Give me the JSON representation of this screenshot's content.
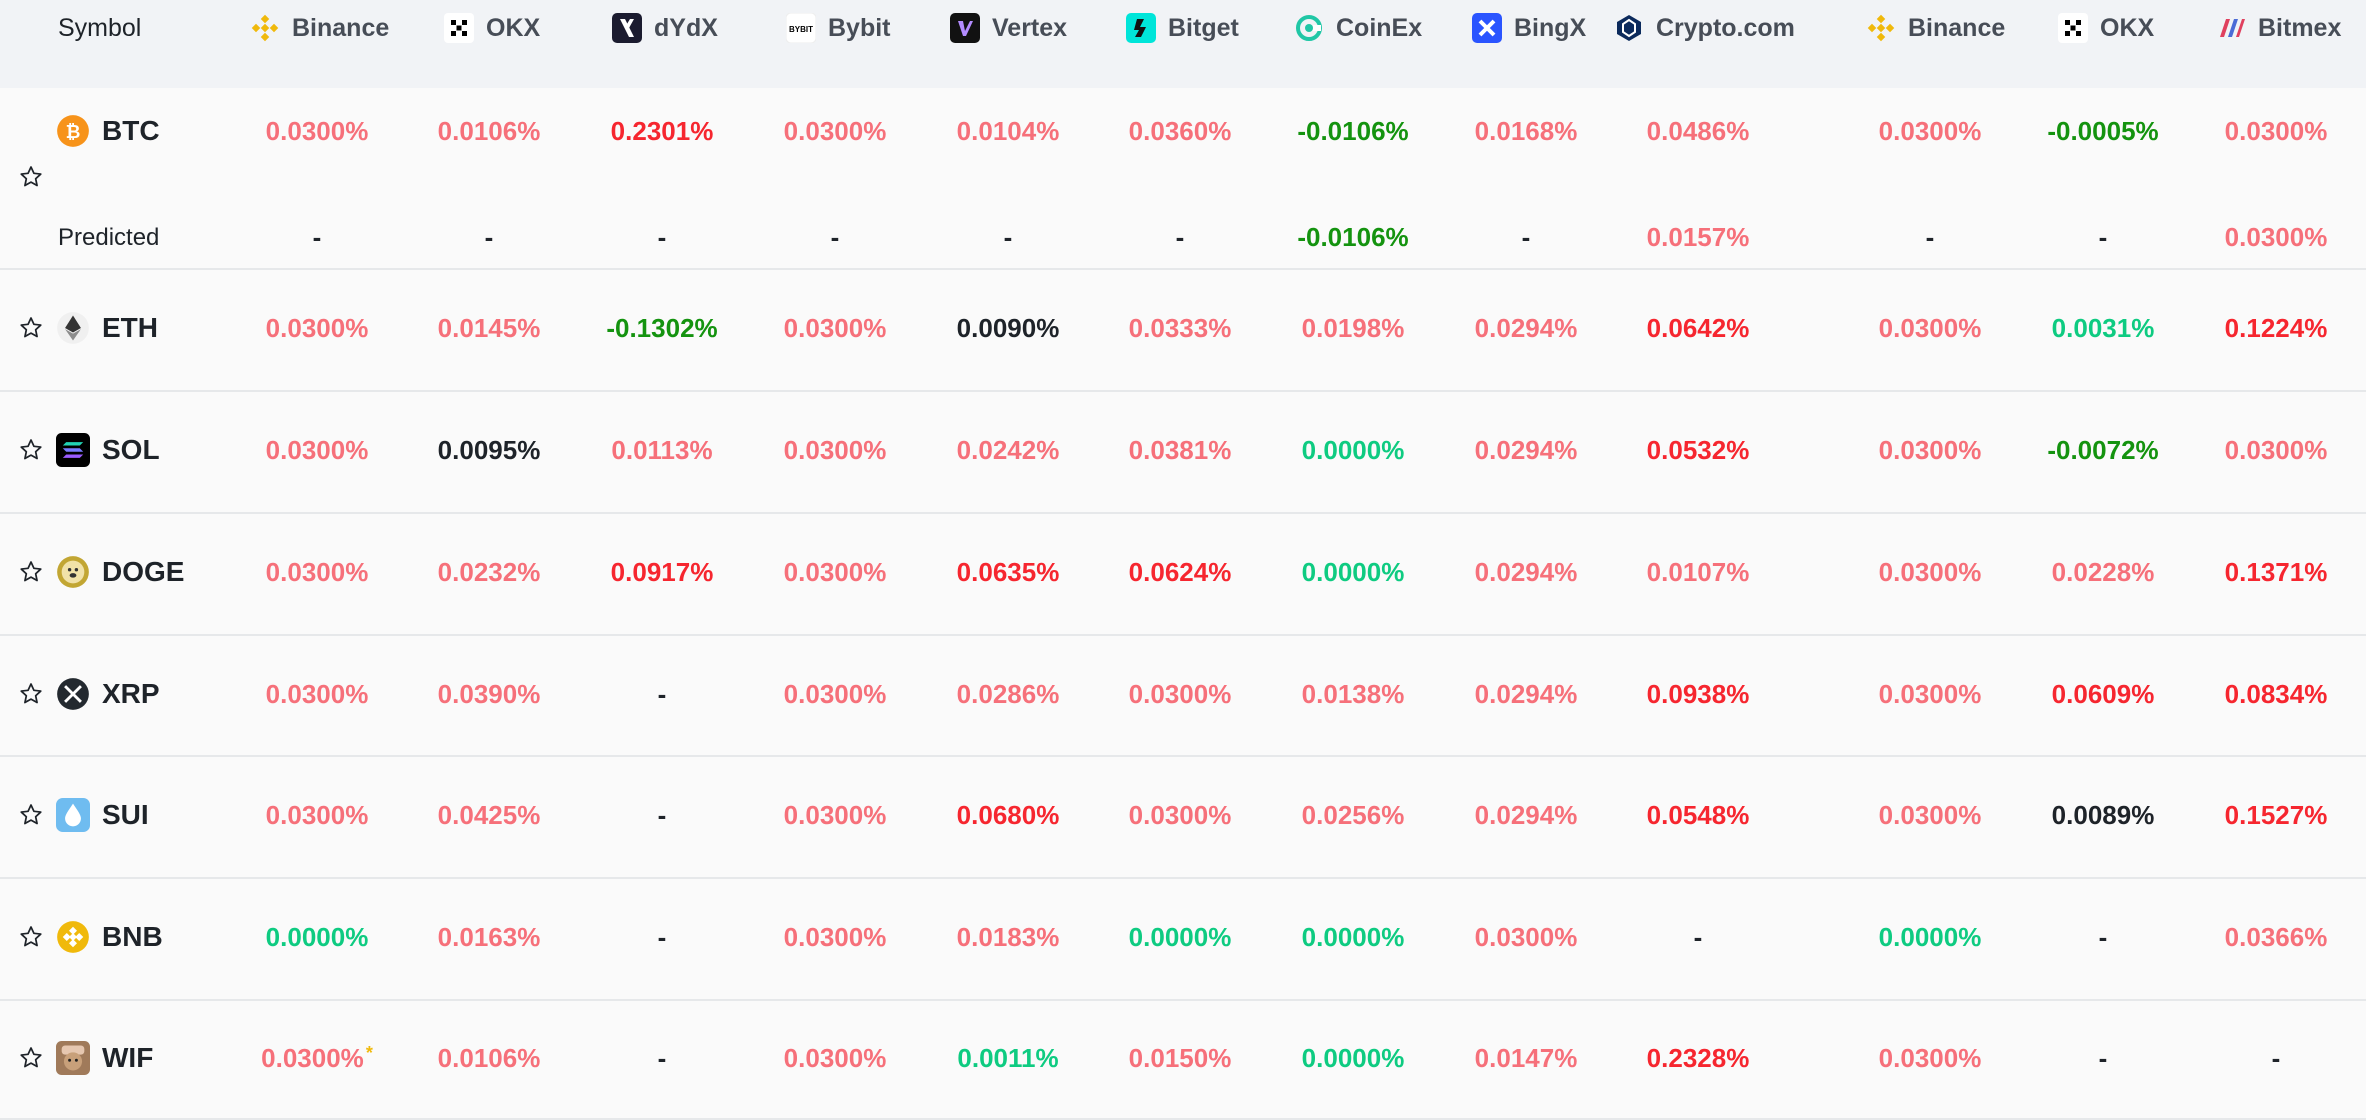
{
  "colors": {
    "positive": "#f6707a",
    "positive_strong": "#f6262f",
    "negative": "#14930f",
    "green": "#0ecb81",
    "neutral": "#1e2329",
    "header_bg": "#f1f3f6"
  },
  "header": {
    "symbol": "Symbol",
    "exchanges": [
      {
        "name": "Binance",
        "icon": "binance-icon"
      },
      {
        "name": "OKX",
        "icon": "okx-icon"
      },
      {
        "name": "dYdX",
        "icon": "dydx-icon"
      },
      {
        "name": "Bybit",
        "icon": "bybit-icon"
      },
      {
        "name": "Vertex",
        "icon": "vertex-icon"
      },
      {
        "name": "Bitget",
        "icon": "bitget-icon"
      },
      {
        "name": "CoinEx",
        "icon": "coinex-icon"
      },
      {
        "name": "BingX",
        "icon": "bingx-icon"
      },
      {
        "name": "Crypto.com",
        "icon": "cryptocom-icon"
      },
      {
        "name": "Binance",
        "icon": "binance-icon"
      },
      {
        "name": "OKX",
        "icon": "okx-icon"
      },
      {
        "name": "Bitmex",
        "icon": "bitmex-icon"
      }
    ]
  },
  "predicted_label": "Predicted",
  "rows": [
    {
      "symbol": "BTC",
      "icon": "btc-icon",
      "rates": [
        [
          "0.0300%",
          "pos"
        ],
        [
          "0.0106%",
          "pos"
        ],
        [
          "0.2301%",
          "strong"
        ],
        [
          "0.0300%",
          "pos"
        ],
        [
          "0.0104%",
          "pos"
        ],
        [
          "0.0360%",
          "pos"
        ],
        [
          "-0.0106%",
          "neg"
        ],
        [
          "0.0168%",
          "pos"
        ],
        [
          "0.0486%",
          "pos"
        ],
        [
          "0.0300%",
          "pos"
        ],
        [
          "-0.0005%",
          "neg"
        ],
        [
          "0.0300%",
          "pos"
        ]
      ],
      "predicted": [
        [
          "-",
          "dash"
        ],
        [
          "-",
          "dash"
        ],
        [
          "-",
          "dash"
        ],
        [
          "-",
          "dash"
        ],
        [
          "-",
          "dash"
        ],
        [
          "-",
          "dash"
        ],
        [
          "-0.0106%",
          "neg"
        ],
        [
          "-",
          "dash"
        ],
        [
          "0.0157%",
          "pos"
        ],
        [
          "-",
          "dash"
        ],
        [
          "-",
          "dash"
        ],
        [
          "0.0300%",
          "pos"
        ]
      ]
    },
    {
      "symbol": "ETH",
      "icon": "eth-icon",
      "rates": [
        [
          "0.0300%",
          "pos"
        ],
        [
          "0.0145%",
          "pos"
        ],
        [
          "-0.1302%",
          "neg"
        ],
        [
          "0.0300%",
          "pos"
        ],
        [
          "0.0090%",
          "neutral"
        ],
        [
          "0.0333%",
          "pos"
        ],
        [
          "0.0198%",
          "pos"
        ],
        [
          "0.0294%",
          "pos"
        ],
        [
          "0.0642%",
          "strong"
        ],
        [
          "0.0300%",
          "pos"
        ],
        [
          "0.0031%",
          "green"
        ],
        [
          "0.1224%",
          "strong"
        ]
      ]
    },
    {
      "symbol": "SOL",
      "icon": "sol-icon",
      "rates": [
        [
          "0.0300%",
          "pos"
        ],
        [
          "0.0095%",
          "neutral"
        ],
        [
          "0.0113%",
          "pos"
        ],
        [
          "0.0300%",
          "pos"
        ],
        [
          "0.0242%",
          "pos"
        ],
        [
          "0.0381%",
          "pos"
        ],
        [
          "0.0000%",
          "green"
        ],
        [
          "0.0294%",
          "pos"
        ],
        [
          "0.0532%",
          "strong"
        ],
        [
          "0.0300%",
          "pos"
        ],
        [
          "-0.0072%",
          "neg"
        ],
        [
          "0.0300%",
          "pos"
        ]
      ]
    },
    {
      "symbol": "DOGE",
      "icon": "doge-icon",
      "rates": [
        [
          "0.0300%",
          "pos"
        ],
        [
          "0.0232%",
          "pos"
        ],
        [
          "0.0917%",
          "strong"
        ],
        [
          "0.0300%",
          "pos"
        ],
        [
          "0.0635%",
          "strong"
        ],
        [
          "0.0624%",
          "strong"
        ],
        [
          "0.0000%",
          "green"
        ],
        [
          "0.0294%",
          "pos"
        ],
        [
          "0.0107%",
          "pos"
        ],
        [
          "0.0300%",
          "pos"
        ],
        [
          "0.0228%",
          "pos"
        ],
        [
          "0.1371%",
          "strong"
        ]
      ]
    },
    {
      "symbol": "XRP",
      "icon": "xrp-icon",
      "rates": [
        [
          "0.0300%",
          "pos"
        ],
        [
          "0.0390%",
          "pos"
        ],
        [
          "-",
          "dash"
        ],
        [
          "0.0300%",
          "pos"
        ],
        [
          "0.0286%",
          "pos"
        ],
        [
          "0.0300%",
          "pos"
        ],
        [
          "0.0138%",
          "pos"
        ],
        [
          "0.0294%",
          "pos"
        ],
        [
          "0.0938%",
          "strong"
        ],
        [
          "0.0300%",
          "pos"
        ],
        [
          "0.0609%",
          "strong"
        ],
        [
          "0.0834%",
          "strong"
        ]
      ]
    },
    {
      "symbol": "SUI",
      "icon": "sui-icon",
      "rates": [
        [
          "0.0300%",
          "pos"
        ],
        [
          "0.0425%",
          "pos"
        ],
        [
          "-",
          "dash"
        ],
        [
          "0.0300%",
          "pos"
        ],
        [
          "0.0680%",
          "strong"
        ],
        [
          "0.0300%",
          "pos"
        ],
        [
          "0.0256%",
          "pos"
        ],
        [
          "0.0294%",
          "pos"
        ],
        [
          "0.0548%",
          "strong"
        ],
        [
          "0.0300%",
          "pos"
        ],
        [
          "0.0089%",
          "neutral"
        ],
        [
          "0.1527%",
          "strong"
        ]
      ]
    },
    {
      "symbol": "BNB",
      "icon": "bnb-icon",
      "rates": [
        [
          "0.0000%",
          "green"
        ],
        [
          "0.0163%",
          "pos"
        ],
        [
          "-",
          "dash"
        ],
        [
          "0.0300%",
          "pos"
        ],
        [
          "0.0183%",
          "pos"
        ],
        [
          "0.0000%",
          "green"
        ],
        [
          "0.0000%",
          "green"
        ],
        [
          "0.0300%",
          "pos"
        ],
        [
          "-",
          "dash"
        ],
        [
          "0.0000%",
          "green"
        ],
        [
          "-",
          "dash"
        ],
        [
          "0.0366%",
          "pos"
        ]
      ]
    },
    {
      "symbol": "WIF",
      "icon": "wif-icon",
      "rates": [
        [
          "0.0300%",
          "pos",
          "*"
        ],
        [
          "0.0106%",
          "pos"
        ],
        [
          "-",
          "dash"
        ],
        [
          "0.0300%",
          "pos"
        ],
        [
          "0.0011%",
          "green"
        ],
        [
          "0.0150%",
          "pos"
        ],
        [
          "0.0000%",
          "green"
        ],
        [
          "0.0147%",
          "pos"
        ],
        [
          "0.2328%",
          "strong"
        ],
        [
          "0.0300%",
          "pos"
        ],
        [
          "-",
          "dash"
        ],
        [
          "-",
          "dash"
        ]
      ]
    }
  ]
}
